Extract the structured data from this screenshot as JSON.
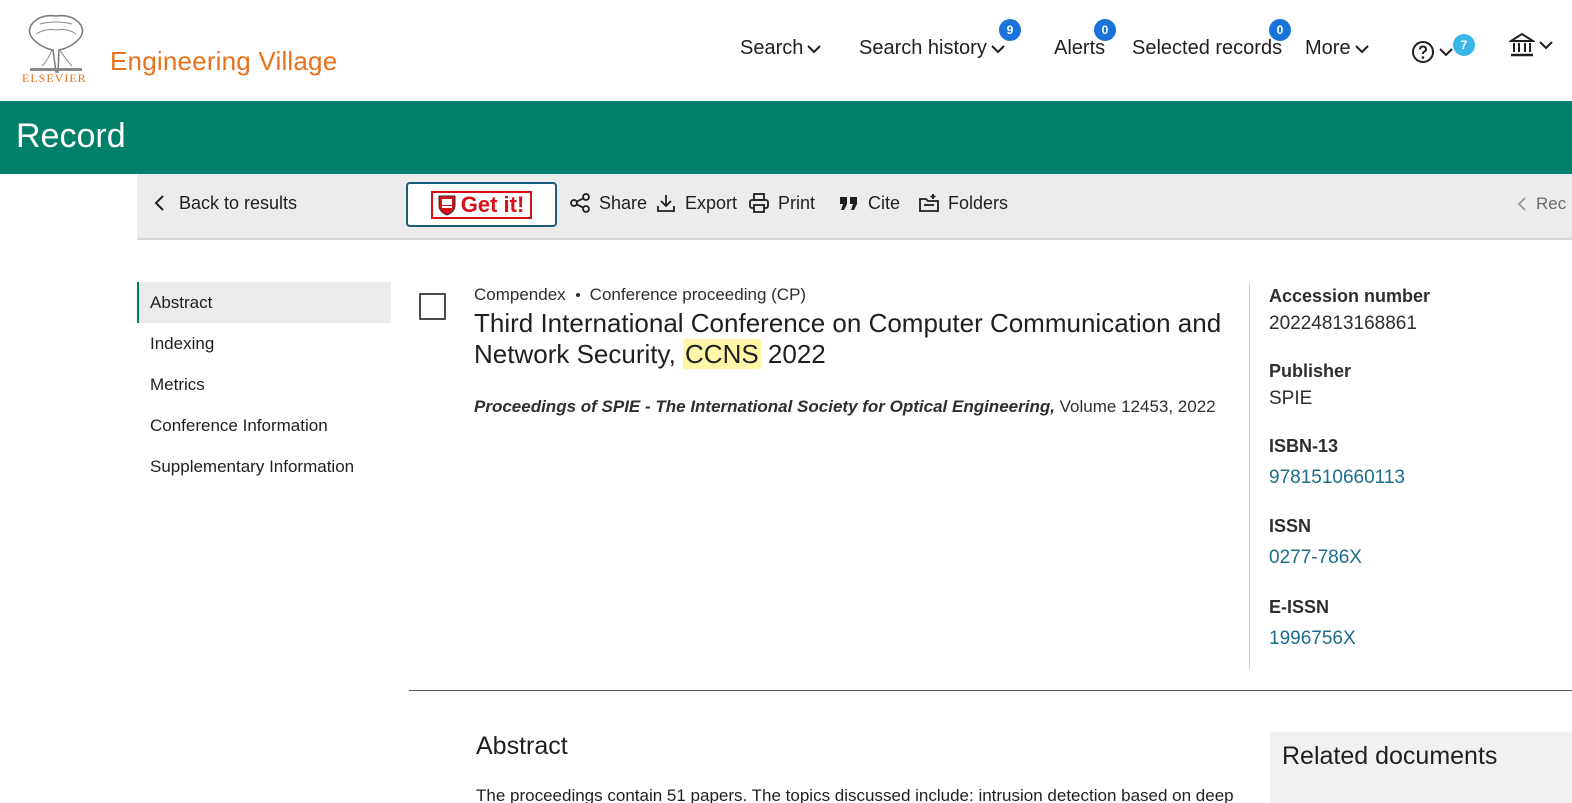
{
  "header": {
    "logo_word": "ELSEVIER",
    "brand": "Engineering Village",
    "nav": {
      "search": "Search",
      "search_history": "Search history",
      "search_history_badge": "9",
      "alerts": "Alerts",
      "alerts_badge": "0",
      "selected_records": "Selected records",
      "selected_records_badge": "0",
      "more": "More",
      "help_badge": "7"
    }
  },
  "band": {
    "title": "Record"
  },
  "toolbar": {
    "back": "Back to results",
    "getit": "Get it!",
    "share": "Share",
    "export": "Export",
    "print": "Print",
    "cite": "Cite",
    "folders": "Folders",
    "rec": "Rec"
  },
  "leftnav": {
    "items": [
      "Abstract",
      "Indexing",
      "Metrics",
      "Conference Information",
      "Supplementary Information"
    ]
  },
  "record": {
    "database": "Compendex",
    "doctype": "Conference proceeding (CP)",
    "title_part1": "Third International Conference on Computer Communication and Network Security, ",
    "title_highlight": "CCNS",
    "title_part2": " 2022",
    "source_title": "Proceedings of SPIE - The International Society for Optical Engineering,",
    "source_rest": " Volume 12453, 2022"
  },
  "details": {
    "accession_label": "Accession number",
    "accession_value": "20224813168861",
    "publisher_label": "Publisher",
    "publisher_value": "SPIE",
    "isbn_label": "ISBN-13",
    "isbn_value": "9781510660113",
    "issn_label": "ISSN",
    "issn_value": "0277-786X",
    "eissn_label": "E-ISSN",
    "eissn_value": "1996756X"
  },
  "abstract": {
    "heading": "Abstract",
    "text": "The proceedings contain 51 papers. The topics discussed include: intrusion detection based on deep"
  },
  "related": {
    "heading": "Related documents"
  },
  "colors": {
    "brand_orange": "#e9711c",
    "band_green": "#007f6b",
    "badge_blue": "#1a73d8",
    "link_blue": "#1b6c8f",
    "highlight": "#fff6a8"
  }
}
